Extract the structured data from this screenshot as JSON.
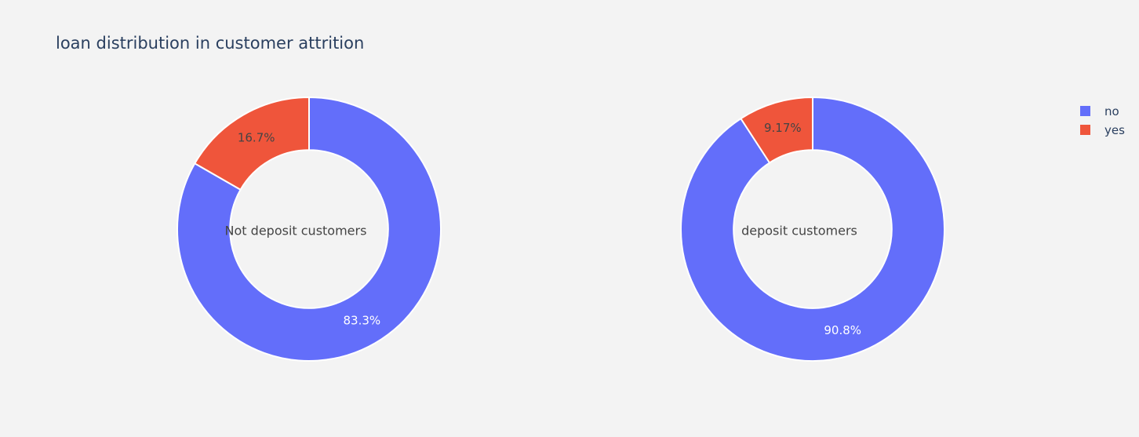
{
  "chart_data": {
    "type": "pie",
    "title": "loan distribution in customer attrition",
    "hole": 0.6,
    "legend": {
      "position": "top-right",
      "items": [
        {
          "label": "no",
          "color": "#636efa"
        },
        {
          "label": "yes",
          "color": "#ef553b"
        }
      ]
    },
    "pies": [
      {
        "center_label": "Not deposit customers",
        "slices": [
          {
            "label": "no",
            "value": 83.3,
            "text": "83.3%",
            "color": "#636efa"
          },
          {
            "label": "yes",
            "value": 16.7,
            "text": "16.7%",
            "color": "#ef553b"
          }
        ]
      },
      {
        "center_label": "deposit customers",
        "slices": [
          {
            "label": "no",
            "value": 90.8,
            "text": "90.8%",
            "color": "#636efa"
          },
          {
            "label": "yes",
            "value": 9.17,
            "text": "9.17%",
            "color": "#ef553b"
          }
        ]
      }
    ]
  },
  "colors": {
    "background": "#f3f3f3",
    "slice_border": "#ffffff",
    "title": "#2a3f5f",
    "center_label": "#444444",
    "inside_label_dark": "#444444",
    "inside_label_light": "#ffffff"
  }
}
